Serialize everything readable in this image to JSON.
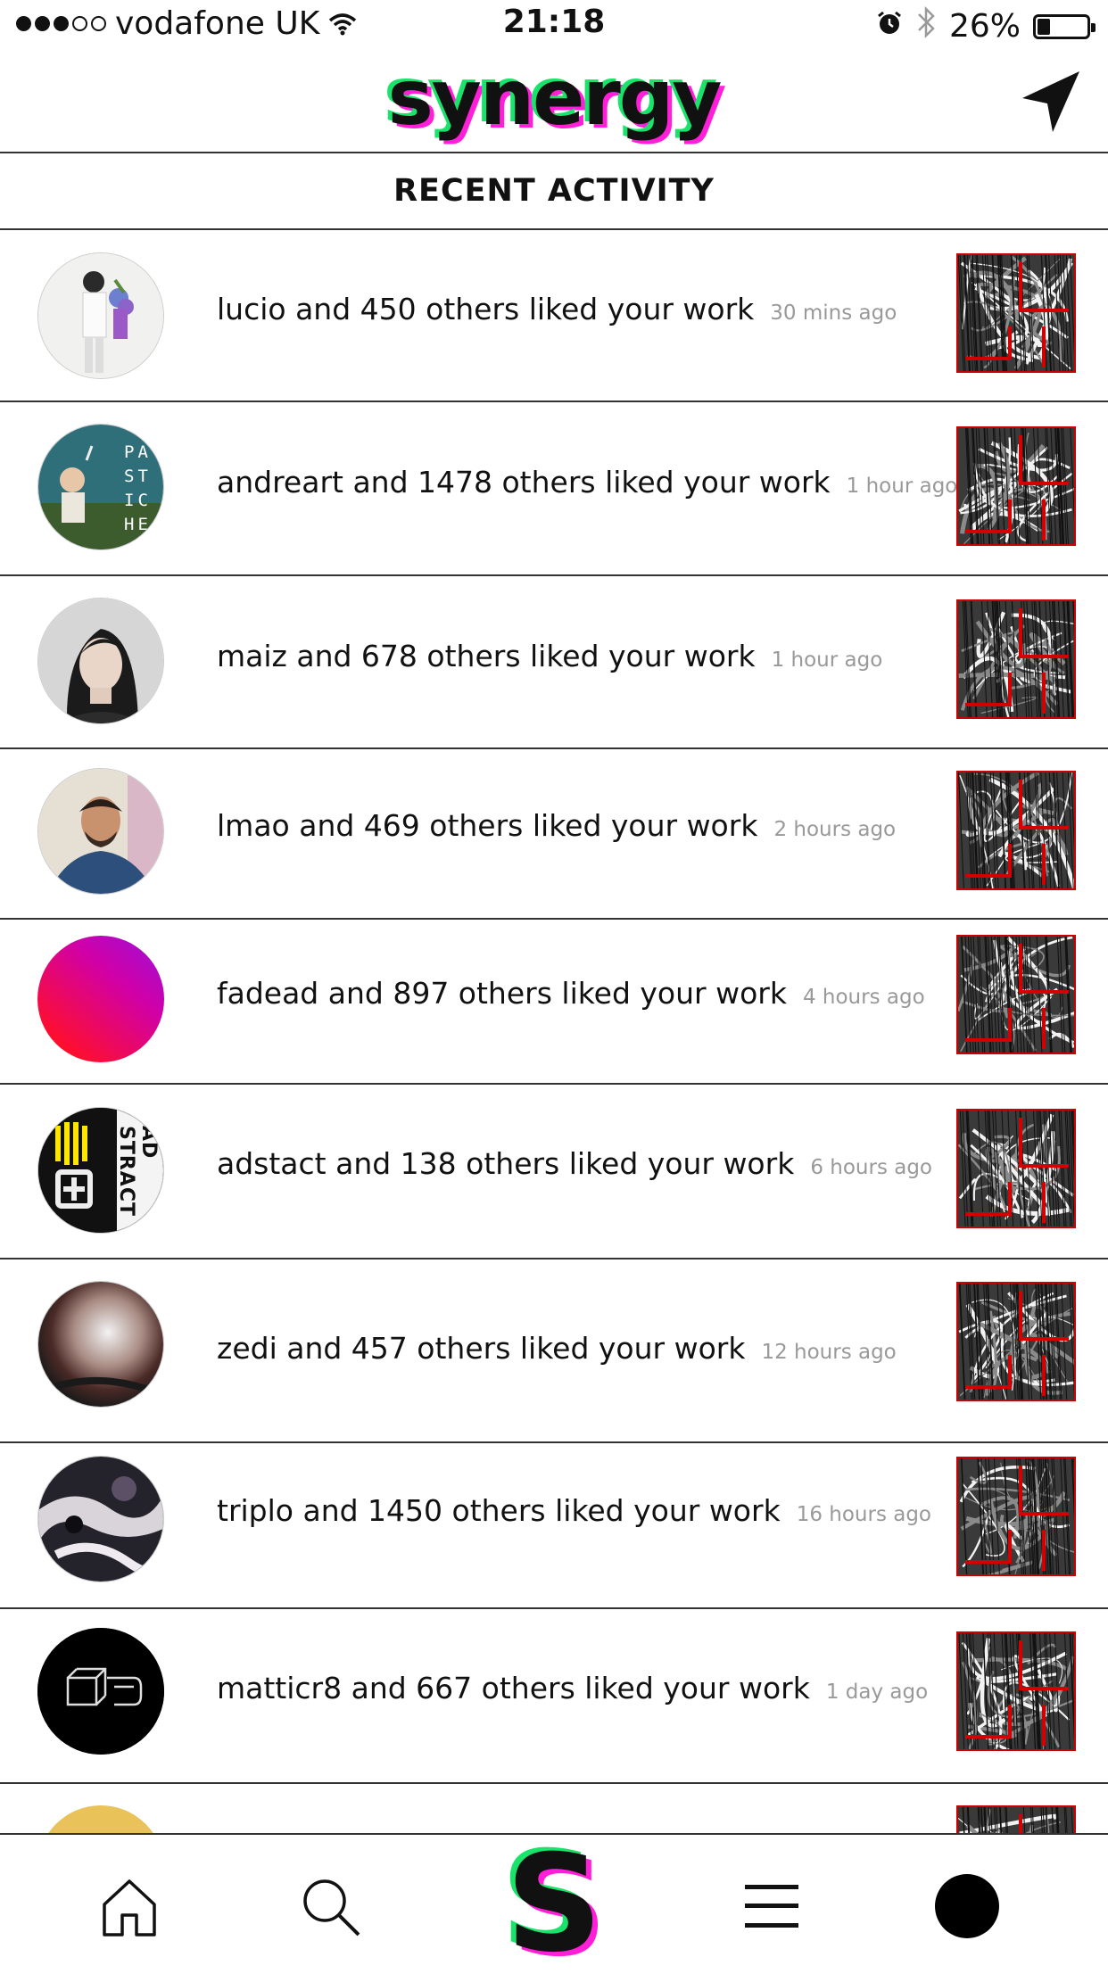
{
  "status_bar": {
    "carrier": "vodafone UK",
    "time": "21:18",
    "battery": "26%",
    "battery_level": 0.26,
    "signal_bars": 3,
    "icons": [
      "wifi-icon",
      "alarm-icon",
      "bluetooth-icon",
      "battery-icon"
    ]
  },
  "header": {
    "logo": "synergy",
    "nav_icon": "location-arrow-icon"
  },
  "section": {
    "title": "RECENT ACTIVITY"
  },
  "activities": [
    {
      "user": "lucio",
      "text": "lucio and 450 others liked your work",
      "time": "30 mins ago"
    },
    {
      "user": "andreart",
      "text": "andreart and 1478 others liked your work",
      "time": "1 hour ago"
    },
    {
      "user": "maiz",
      "text": "maiz and 678 others liked your work",
      "time": "1 hour ago"
    },
    {
      "user": "lmao",
      "text": "lmao and 469 others liked your work",
      "time": "2 hours ago"
    },
    {
      "user": "fadead",
      "text": "fadead and 897 others liked your work",
      "time": "4 hours ago"
    },
    {
      "user": "adstact",
      "text": "adstact and 138 others liked your work",
      "time": "6 hours ago"
    },
    {
      "user": "zedi",
      "text": "zedi and 457 others liked your work",
      "time": "12 hours ago"
    },
    {
      "user": "triplo",
      "text": "triplo and 1450 others liked your work",
      "time": "16 hours ago"
    },
    {
      "user": "matticr8",
      "text": "matticr8 and 667 others liked your work",
      "time": "1 day ago"
    }
  ],
  "avatar_text": {
    "pastiche": [
      "PA",
      "ST",
      "IC",
      "HE"
    ],
    "abstract": "AD STRACT"
  },
  "tab_bar": {
    "tabs": [
      "home-icon",
      "search-icon",
      "synergy-s-icon",
      "menu-icon",
      "profile-icon"
    ],
    "center_label": "S"
  },
  "colors": {
    "accent_green": "#19e36a",
    "accent_pink": "#ff1fd8",
    "thumb_border": "#cc0000"
  }
}
